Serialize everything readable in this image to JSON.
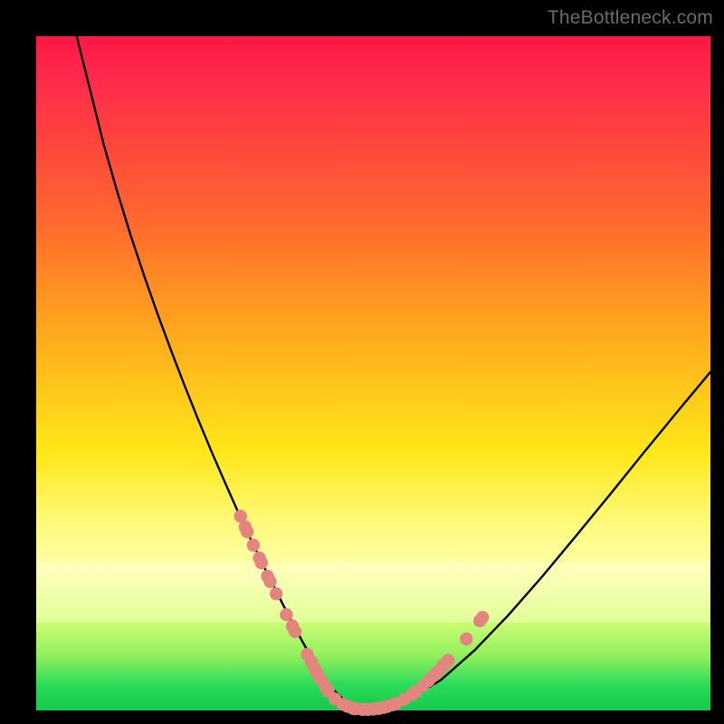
{
  "watermark": "TheBottleneck.com",
  "chart_data": {
    "type": "line",
    "title": "",
    "xlabel": "",
    "ylabel": "",
    "xlim": [
      0,
      100
    ],
    "ylim": [
      0,
      100
    ],
    "grid": false,
    "legend": false,
    "series": [
      {
        "name": "bottleneck-curve",
        "x": [
          6,
          8,
          10,
          12,
          14,
          16,
          18,
          20,
          22,
          24,
          26,
          28,
          30,
          32,
          33.5,
          35,
          36.5,
          38,
          39.5,
          41,
          43,
          46,
          50,
          55,
          60,
          65,
          70,
          75,
          80,
          85,
          90,
          95,
          100
        ],
        "y": [
          100,
          92,
          84,
          77,
          70.5,
          64.5,
          58.8,
          53.4,
          48.2,
          43.2,
          38.4,
          33.8,
          29.3,
          25,
          21.9,
          18.9,
          15.9,
          13,
          10.2,
          7.5,
          4.1,
          1.2,
          0.2,
          1.5,
          4.5,
          8.9,
          14.1,
          19.8,
          25.8,
          31.9,
          38.1,
          44.2,
          50.2
        ]
      }
    ],
    "markers": {
      "name": "highlight-points",
      "color": "#e4847e",
      "points": [
        {
          "x": 30.3,
          "y": 28.8
        },
        {
          "x": 31.0,
          "y": 27.2
        },
        {
          "x": 31.3,
          "y": 26.5
        },
        {
          "x": 32.2,
          "y": 24.5
        },
        {
          "x": 33.1,
          "y": 22.6
        },
        {
          "x": 33.4,
          "y": 21.9
        },
        {
          "x": 34.3,
          "y": 19.9
        },
        {
          "x": 34.7,
          "y": 19.1
        },
        {
          "x": 35.6,
          "y": 17.3
        },
        {
          "x": 37.1,
          "y": 14.2
        },
        {
          "x": 38.0,
          "y": 12.5
        },
        {
          "x": 38.4,
          "y": 11.7
        },
        {
          "x": 40.2,
          "y": 8.3
        },
        {
          "x": 40.8,
          "y": 7.2
        },
        {
          "x": 41.4,
          "y": 6.1
        },
        {
          "x": 41.7,
          "y": 5.5
        },
        {
          "x": 42.3,
          "y": 4.5
        },
        {
          "x": 43.0,
          "y": 3.4
        },
        {
          "x": 43.3,
          "y": 2.9
        },
        {
          "x": 44.3,
          "y": 1.7
        },
        {
          "x": 45.5,
          "y": 0.9
        },
        {
          "x": 46.2,
          "y": 0.6
        },
        {
          "x": 47.0,
          "y": 0.3
        },
        {
          "x": 47.4,
          "y": 0.25
        },
        {
          "x": 48.4,
          "y": 0.15
        },
        {
          "x": 49.2,
          "y": 0.15
        },
        {
          "x": 50.0,
          "y": 0.2
        },
        {
          "x": 50.8,
          "y": 0.3
        },
        {
          "x": 51.5,
          "y": 0.45
        },
        {
          "x": 52.1,
          "y": 0.6
        },
        {
          "x": 52.9,
          "y": 0.85
        },
        {
          "x": 53.4,
          "y": 1.05
        },
        {
          "x": 54.6,
          "y": 1.65
        },
        {
          "x": 55.8,
          "y": 2.4
        },
        {
          "x": 56.3,
          "y": 2.8
        },
        {
          "x": 57.4,
          "y": 3.7
        },
        {
          "x": 58.2,
          "y": 4.4
        },
        {
          "x": 58.9,
          "y": 5.1
        },
        {
          "x": 59.6,
          "y": 5.8
        },
        {
          "x": 60.3,
          "y": 6.6
        },
        {
          "x": 60.8,
          "y": 7.1
        },
        {
          "x": 61.1,
          "y": 7.4
        },
        {
          "x": 63.8,
          "y": 10.6
        },
        {
          "x": 65.8,
          "y": 13.3
        },
        {
          "x": 66.2,
          "y": 13.8
        }
      ]
    }
  }
}
